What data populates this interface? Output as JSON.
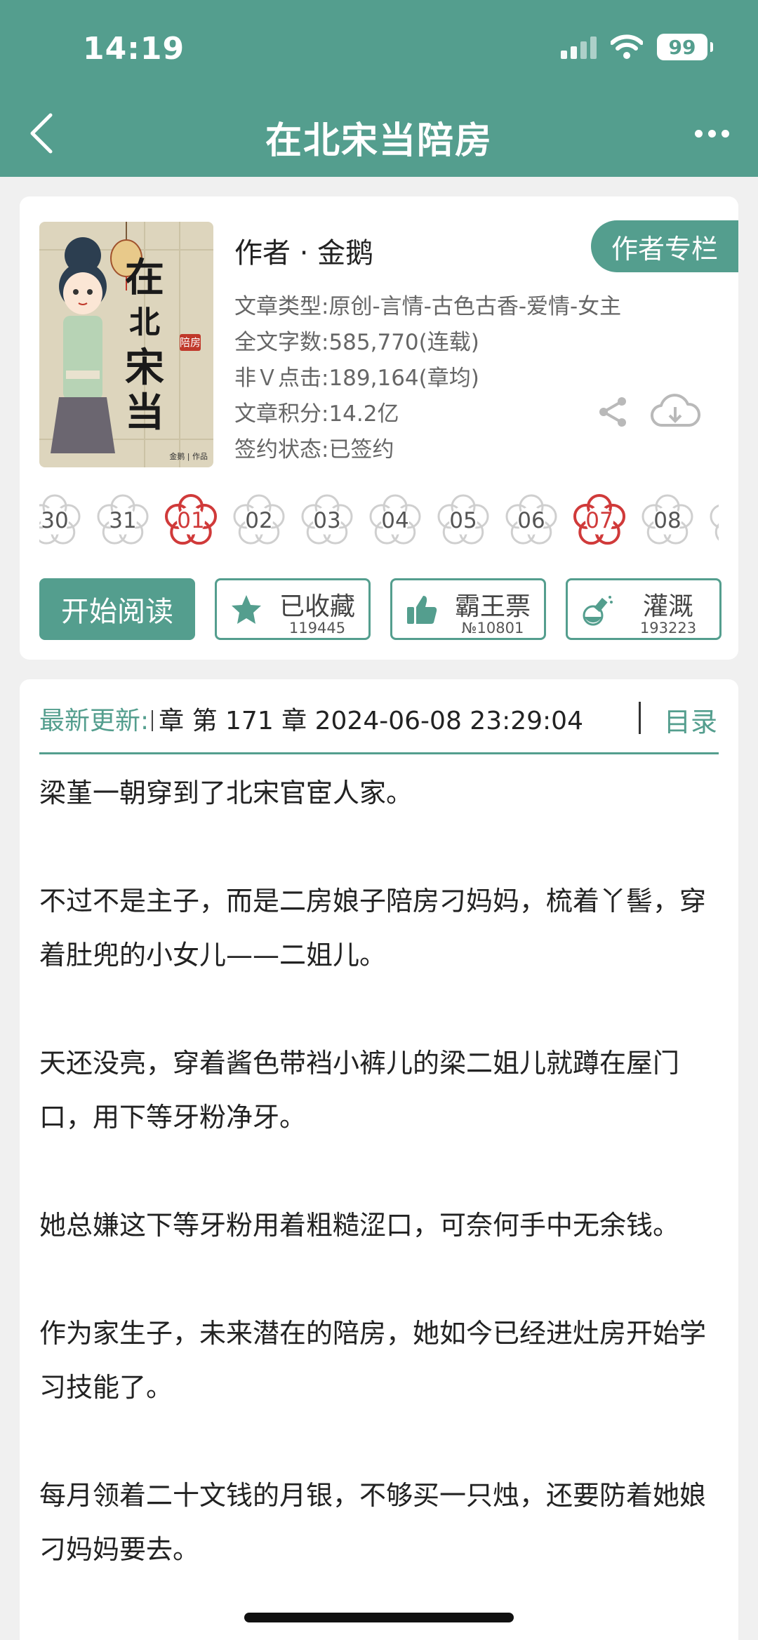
{
  "status_bar": {
    "time": "14:19",
    "battery": "99"
  },
  "nav": {
    "title": "在北宋当陪房"
  },
  "book": {
    "author": "作者 · 金鹅",
    "author_column_label": "作者专栏",
    "meta": {
      "genre": "文章类型:原创-言情-古色古香-爱情-女主",
      "word_count": "全文字数:585,770(连载)",
      "clicks": "非Ｖ点击:189,164(章均)",
      "score": "文章积分:14.2亿",
      "contract": "签约状态:已签约"
    },
    "cover": {
      "title_chars": [
        "在",
        "北",
        "宋",
        "当"
      ],
      "seal": "陪房",
      "signature": "金鹅 | 作品"
    }
  },
  "chapter_flowers": [
    {
      "label": "30",
      "active": false
    },
    {
      "label": "31",
      "active": false
    },
    {
      "label": "01",
      "active": true
    },
    {
      "label": "02",
      "active": false
    },
    {
      "label": "03",
      "active": false
    },
    {
      "label": "04",
      "active": false
    },
    {
      "label": "05",
      "active": false
    },
    {
      "label": "06",
      "active": false
    },
    {
      "label": "07",
      "active": true
    },
    {
      "label": "08",
      "active": false
    },
    {
      "label": "",
      "active": false
    }
  ],
  "actions": {
    "read": "开始阅读",
    "favorite": {
      "label": "已收藏",
      "count": "119445",
      "icon": "star-icon"
    },
    "ticket": {
      "label": "霸王票",
      "count": "№10801",
      "icon": "thumbs-up-icon"
    },
    "water": {
      "label": "灌溉",
      "count": "193223",
      "icon": "watering-flask-icon"
    }
  },
  "latest": {
    "label": "最新更新:",
    "text": "章 第 171 章 2024-06-08 23:29:04",
    "toc": "目录"
  },
  "content": {
    "paragraphs": [
      "梁堇一朝穿到了北宋官宦人家。",
      "不过不是主子，而是二房娘子陪房刁妈妈，梳着丫髻，穿着肚兜的小女儿——二姐儿。",
      "天还没亮，穿着酱色带裆小裤儿的梁二姐儿就蹲在屋门口，用下等牙粉净牙。",
      "她总嫌这下等牙粉用着粗糙涩口，可奈何手中无余钱。",
      "作为家生子，未来潜在的陪房，她如今已经进灶房开始学习技能了。",
      "每月领着二十文钱的月银，不够买一只烛，还要防着她娘刁妈妈要去。"
    ]
  },
  "colors": {
    "brand": "#549e8e",
    "flower_active": "#d03a3a"
  }
}
